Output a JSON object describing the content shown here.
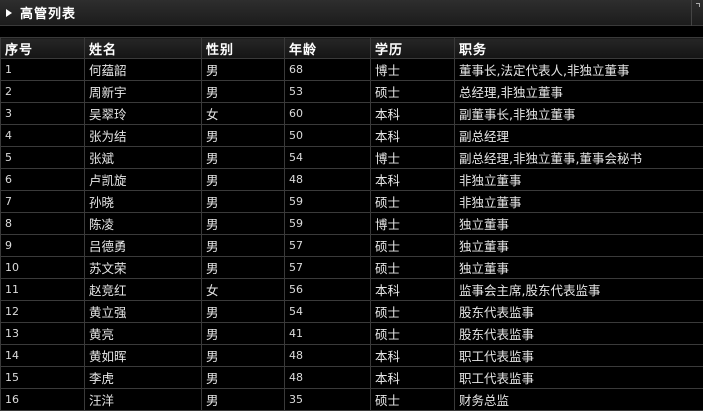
{
  "panel": {
    "title": "高管列表"
  },
  "table": {
    "headers": [
      "序号",
      "姓名",
      "性别",
      "年龄",
      "学历",
      "职务"
    ],
    "rows": [
      [
        "1",
        "何蕴韶",
        "男",
        "68",
        "博士",
        "董事长,法定代表人,非独立董事"
      ],
      [
        "2",
        "周新宇",
        "男",
        "53",
        "硕士",
        "总经理,非独立董事"
      ],
      [
        "3",
        "吴翠玲",
        "女",
        "60",
        "本科",
        "副董事长,非独立董事"
      ],
      [
        "4",
        "张为结",
        "男",
        "50",
        "本科",
        "副总经理"
      ],
      [
        "5",
        "张斌",
        "男",
        "54",
        "博士",
        "副总经理,非独立董事,董事会秘书"
      ],
      [
        "6",
        "卢凯旋",
        "男",
        "48",
        "本科",
        "非独立董事"
      ],
      [
        "7",
        "孙晓",
        "男",
        "59",
        "硕士",
        "非独立董事"
      ],
      [
        "8",
        "陈凌",
        "男",
        "59",
        "博士",
        "独立董事"
      ],
      [
        "9",
        "吕德勇",
        "男",
        "57",
        "硕士",
        "独立董事"
      ],
      [
        "10",
        "苏文荣",
        "男",
        "57",
        "硕士",
        "独立董事"
      ],
      [
        "11",
        "赵竞红",
        "女",
        "56",
        "本科",
        "监事会主席,股东代表监事"
      ],
      [
        "12",
        "黄立强",
        "男",
        "54",
        "硕士",
        "股东代表监事"
      ],
      [
        "13",
        "黄亮",
        "男",
        "41",
        "硕士",
        "股东代表监事"
      ],
      [
        "14",
        "黄如晖",
        "男",
        "48",
        "本科",
        "职工代表监事"
      ],
      [
        "15",
        "李虎",
        "男",
        "48",
        "本科",
        "职工代表监事"
      ],
      [
        "16",
        "汪洋",
        "男",
        "35",
        "硕士",
        "财务总监"
      ]
    ]
  }
}
